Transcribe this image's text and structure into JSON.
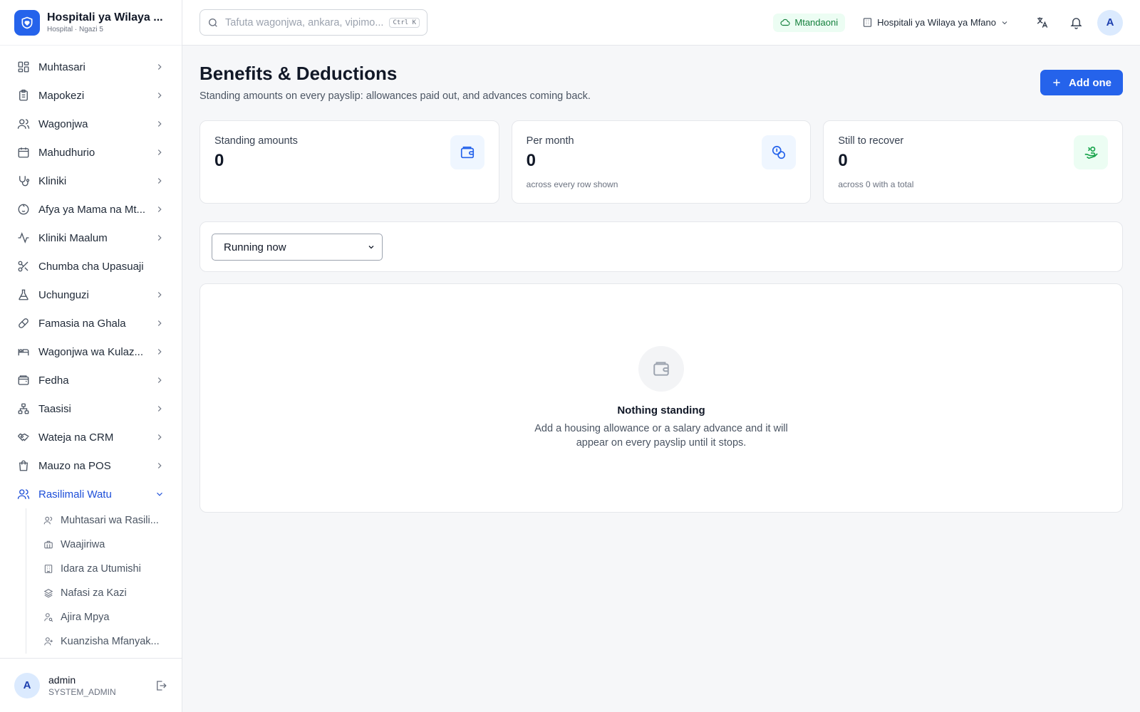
{
  "brand": {
    "name": "Hospitali ya Wilaya ...",
    "subtitle": "Hospital · Ngazi 5",
    "icon": "heart-shield-icon",
    "color": "#2563eb"
  },
  "sidebar": {
    "items": [
      {
        "label": "Muhtasari",
        "icon": "dashboard-icon",
        "has_chevron": true
      },
      {
        "label": "Mapokezi",
        "icon": "clipboard-icon",
        "has_chevron": true
      },
      {
        "label": "Wagonjwa",
        "icon": "users-icon",
        "has_chevron": true
      },
      {
        "label": "Mahudhurio",
        "icon": "calendar-icon",
        "has_chevron": true
      },
      {
        "label": "Kliniki",
        "icon": "stethoscope-icon",
        "has_chevron": true
      },
      {
        "label": "Afya ya Mama na Mt...",
        "icon": "baby-icon",
        "has_chevron": true
      },
      {
        "label": "Kliniki Maalum",
        "icon": "activity-icon",
        "has_chevron": true
      },
      {
        "label": "Chumba cha Upasuaji",
        "icon": "scissors-icon",
        "has_chevron": false
      },
      {
        "label": "Uchunguzi",
        "icon": "flask-icon",
        "has_chevron": true
      },
      {
        "label": "Famasia na Ghala",
        "icon": "pill-icon",
        "has_chevron": true
      },
      {
        "label": "Wagonjwa wa Kulaz...",
        "icon": "bed-icon",
        "has_chevron": true
      },
      {
        "label": "Fedha",
        "icon": "wallet-icon",
        "has_chevron": true
      },
      {
        "label": "Taasisi",
        "icon": "network-icon",
        "has_chevron": true
      },
      {
        "label": "Wateja na CRM",
        "icon": "handshake-icon",
        "has_chevron": true
      },
      {
        "label": "Mauzo na POS",
        "icon": "shopping-bag-icon",
        "has_chevron": true
      },
      {
        "label": "Rasilimali Watu",
        "icon": "users-icon",
        "has_chevron": true,
        "expanded": true
      }
    ],
    "subitems": [
      {
        "label": "Muhtasari wa Rasili...",
        "icon": "users-icon"
      },
      {
        "label": "Waajiriwa",
        "icon": "briefcase-icon"
      },
      {
        "label": "Idara za Utumishi",
        "icon": "building-icon"
      },
      {
        "label": "Nafasi za Kazi",
        "icon": "layers-icon"
      },
      {
        "label": "Ajira Mpya",
        "icon": "user-search-icon"
      },
      {
        "label": "Kuanzisha Mfanyak...",
        "icon": "user-plus-icon"
      }
    ]
  },
  "user": {
    "initial": "A",
    "name": "admin",
    "role": "SYSTEM_ADMIN"
  },
  "topbar": {
    "search_placeholder": "Tafuta wagonjwa, ankara, vipimo...",
    "shortcut": "Ctrl K",
    "status": "Mtandaoni",
    "facility": "Hospitali ya Wilaya ya Mfano",
    "avatar_initial": "A"
  },
  "page": {
    "title": "Benefits & Deductions",
    "subtitle": "Standing amounts on every payslip: allowances paid out, and advances coming back.",
    "add_label": "Add one"
  },
  "stats": [
    {
      "label": "Standing amounts",
      "value": "0",
      "note": "",
      "icon": "wallet-icon",
      "accent": "#2563eb"
    },
    {
      "label": "Per month",
      "value": "0",
      "note": "across every row shown",
      "icon": "coins-icon",
      "accent": "#2563eb"
    },
    {
      "label": "Still to recover",
      "value": "0",
      "note": "across 0 with a total",
      "icon": "hand-coins-icon",
      "accent": "#16a34a"
    }
  ],
  "filter": {
    "selected": "Running now"
  },
  "empty": {
    "title": "Nothing standing",
    "text": "Add a housing allowance or a salary advance and it will appear on every payslip until it stops."
  }
}
